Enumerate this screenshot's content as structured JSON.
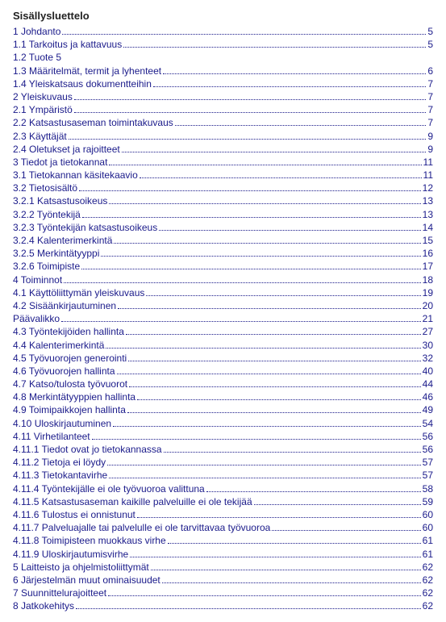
{
  "title": "Sisällysluettelo",
  "entries": [
    {
      "label": "1 Johdanto",
      "page": "5"
    },
    {
      "label": "1.1 Tarkoitus ja kattavuus",
      "page": "5"
    },
    {
      "label": "1.2 Tuote 5",
      "page": ""
    },
    {
      "label": "1.3 Määritelmät, termit ja lyhenteet",
      "page": "6"
    },
    {
      "label": "1.4 Yleiskatsaus dokumentteihin",
      "page": "7"
    },
    {
      "label": "2 Yleiskuvaus",
      "page": "7"
    },
    {
      "label": "2.1 Ympäristö",
      "page": "7"
    },
    {
      "label": "2.2 Katsastusaseman toimintakuvaus",
      "page": "7"
    },
    {
      "label": "2.3 Käyttäjät",
      "page": "9"
    },
    {
      "label": "2.4 Oletukset ja rajoitteet",
      "page": "9"
    },
    {
      "label": "3 Tiedot ja tietokannat",
      "page": "11"
    },
    {
      "label": "3.1 Tietokannan käsitekaavio",
      "page": "11"
    },
    {
      "label": "3.2 Tietosisältö",
      "page": "12"
    },
    {
      "label": "3.2.1 Katsastusoikeus",
      "page": "13"
    },
    {
      "label": "3.2.2 Työntekijä",
      "page": "13"
    },
    {
      "label": "3.2.3 Työntekijän katsastusoikeus",
      "page": "14"
    },
    {
      "label": "3.2.4 Kalenterimerkintä",
      "page": "15"
    },
    {
      "label": "3.2.5 Merkintätyyppi",
      "page": "16"
    },
    {
      "label": "3.2.6 Toimipiste",
      "page": "17"
    },
    {
      "label": "4 Toiminnot",
      "page": "18"
    },
    {
      "label": "4.1 Käyttöliittymän yleiskuvaus",
      "page": "19"
    },
    {
      "label": "4.2 Sisäänkirjautuminen",
      "page": "20"
    },
    {
      "label": "Päävalikko",
      "page": "21"
    },
    {
      "label": "4.3 Työntekijöiden hallinta",
      "page": "27"
    },
    {
      "label": "4.4 Kalenterimerkintä",
      "page": "30"
    },
    {
      "label": "4.5 Työvuorojen generointi",
      "page": "32"
    },
    {
      "label": "4.6 Työvuorojen hallinta",
      "page": "40"
    },
    {
      "label": "4.7 Katso/tulosta työvuorot",
      "page": "44"
    },
    {
      "label": "4.8 Merkintätyyppien hallinta",
      "page": "46"
    },
    {
      "label": "4.9 Toimipaikkojen hallinta",
      "page": "49"
    },
    {
      "label": "4.10 Uloskirjautuminen",
      "page": "54"
    },
    {
      "label": "4.11 Virhetilanteet",
      "page": "56"
    },
    {
      "label": "4.11.1 Tiedot ovat jo tietokannassa",
      "page": "56"
    },
    {
      "label": "4.11.2 Tietoja ei löydy",
      "page": "57"
    },
    {
      "label": "4.11.3 Tietokantavirhe",
      "page": "57"
    },
    {
      "label": "4.11.4 Työntekijälle ei ole työvuoroa valittuna",
      "page": "58"
    },
    {
      "label": "4.11.5 Katsastusaseman kaikille palveluille ei ole tekijää",
      "page": "59"
    },
    {
      "label": "4.11.6 Tulostus ei onnistunut",
      "page": "60"
    },
    {
      "label": "4.11.7 Palveluajalle tai palvelulle ei ole tarvittavaa työvuoroa",
      "page": "60"
    },
    {
      "label": "4.11.8 Toimipisteen muokkaus virhe",
      "page": "61"
    },
    {
      "label": "4.11.9 Uloskirjautumisvirhe",
      "page": "61"
    },
    {
      "label": "5 Laitteisto ja ohjelmistoliittymät",
      "page": "62"
    },
    {
      "label": "6 Järjestelmän muut ominaisuudet",
      "page": "62"
    },
    {
      "label": "7  Suunnittelurajoitteet",
      "page": "62"
    },
    {
      "label": "8  Jatkokehitys",
      "page": "62"
    }
  ]
}
